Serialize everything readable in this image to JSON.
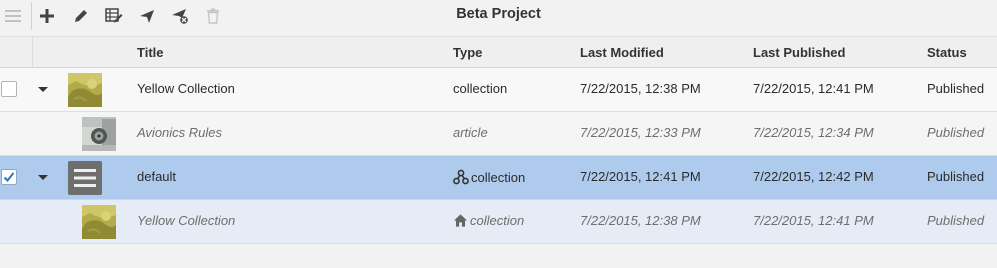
{
  "toolbar": {
    "title": "Beta Project",
    "icons": [
      "menu-icon",
      "add-icon",
      "edit-icon",
      "edit-grid-icon",
      "publish-icon",
      "unpublish-icon",
      "delete-icon"
    ]
  },
  "table": {
    "headers": {
      "title": "Title",
      "type": "Type",
      "last_modified": "Last Modified",
      "last_published": "Last Published",
      "status": "Status"
    },
    "rows": [
      {
        "title": "Yellow Collection",
        "type": "collection",
        "last_modified": "7/22/2015, 12:38 PM",
        "last_published": "7/22/2015, 12:41 PM",
        "status": "Published",
        "checked": false,
        "thumbnail": "yellow-collection-thumbnail"
      },
      {
        "title": "Avionics Rules",
        "type": "article",
        "last_modified": "7/22/2015, 12:33 PM",
        "last_published": "7/22/2015, 12:34 PM",
        "status": "Published",
        "thumbnail": "avionics-thumbnail"
      },
      {
        "title": "default",
        "type": "collection",
        "type_icon": "network-icon",
        "last_modified": "7/22/2015, 12:41 PM",
        "last_published": "7/22/2015, 12:42 PM",
        "status": "Published",
        "checked": true,
        "thumbnail": "default-collection-thumbnail"
      },
      {
        "title": "Yellow Collection",
        "type": "collection",
        "type_icon": "home-icon",
        "last_modified": "7/22/2015, 12:38 PM",
        "last_published": "7/22/2015, 12:41 PM",
        "status": "Published",
        "thumbnail": "yellow-collection-thumbnail"
      }
    ]
  },
  "colors": {
    "selected_row": "#aecbee",
    "selected_child_row": "#e5ecf5",
    "checkbox_check": "#2b74c7"
  }
}
